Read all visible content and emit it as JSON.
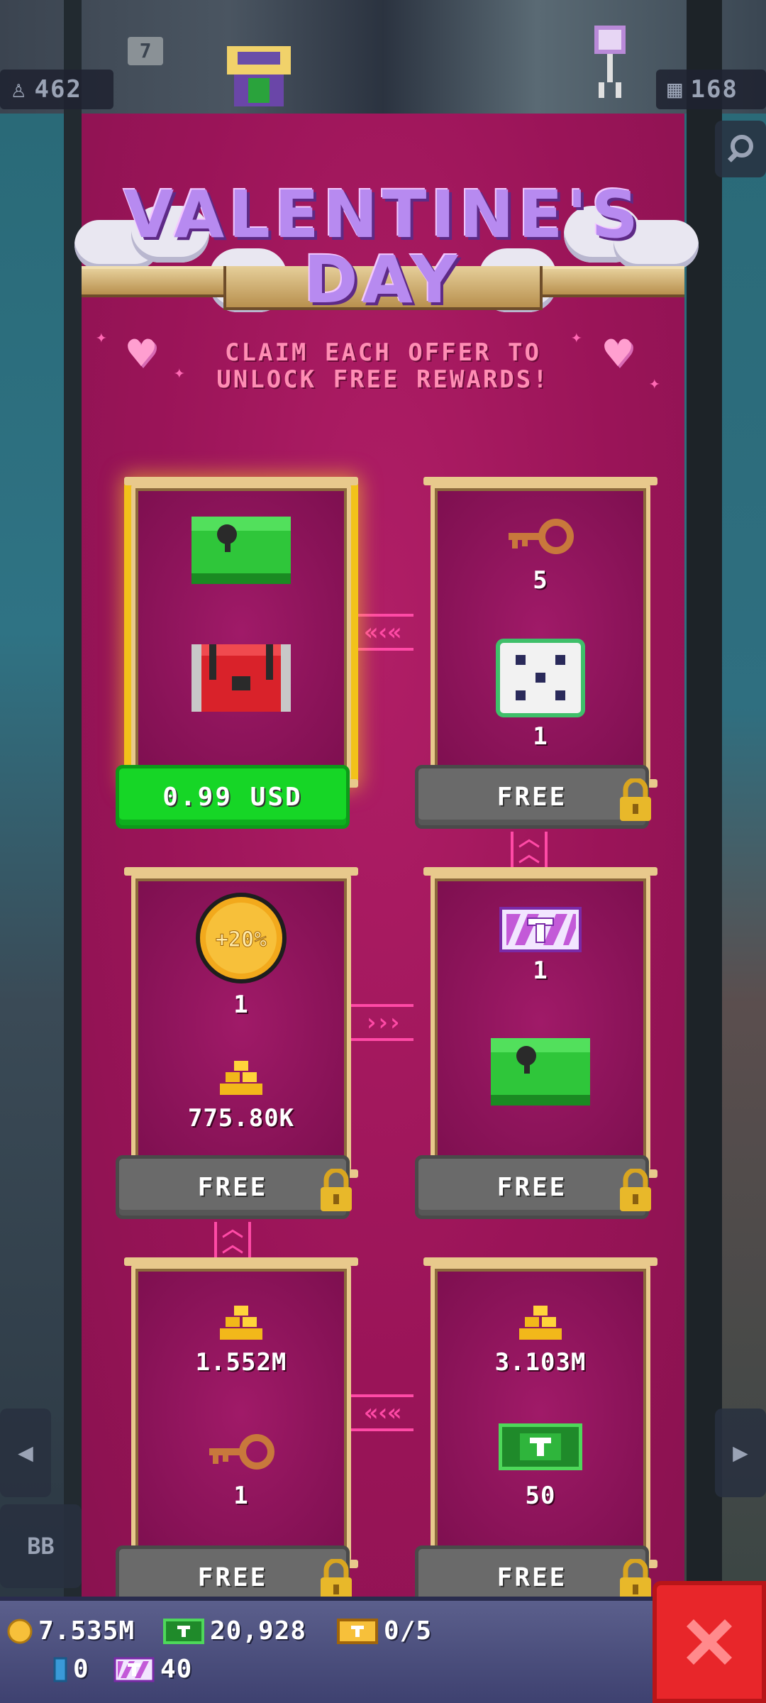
{
  "hud": {
    "population": "462",
    "floors": "168",
    "floor_badge": "7"
  },
  "nav": {
    "bb_label": "BB"
  },
  "event": {
    "title_line1": "VALENTINE'S",
    "title_line2": "DAY",
    "subtitle_line1": "CLAIM EACH OFFER TO",
    "subtitle_line2": "UNLOCK FREE REWARDS!"
  },
  "offers": [
    {
      "items": [
        {
          "icon": "green-chest-icon",
          "label": ""
        },
        {
          "icon": "red-chest-icon",
          "label": ""
        }
      ],
      "button": "0.99 USD",
      "locked": false
    },
    {
      "items": [
        {
          "icon": "key-icon",
          "label": "5"
        },
        {
          "icon": "dice-icon",
          "label": "1"
        }
      ],
      "button": "FREE",
      "locked": true
    },
    {
      "items": [
        {
          "icon": "coin-boost-icon",
          "label": "1",
          "text": "+20%"
        },
        {
          "icon": "gold-stack-icon",
          "label": "775.80K"
        }
      ],
      "button": "FREE",
      "locked": true
    },
    {
      "items": [
        {
          "icon": "ticket-icon",
          "label": "1"
        },
        {
          "icon": "green-chest-icon",
          "label": ""
        }
      ],
      "button": "FREE",
      "locked": true
    },
    {
      "items": [
        {
          "icon": "gold-stack-icon",
          "label": "1.552M"
        },
        {
          "icon": "key-icon",
          "label": "1"
        }
      ],
      "button": "FREE",
      "locked": true
    },
    {
      "items": [
        {
          "icon": "gold-stack-icon",
          "label": "3.103M"
        },
        {
          "icon": "bux-icon",
          "label": "50"
        }
      ],
      "button": "FREE",
      "locked": true
    }
  ],
  "resources": {
    "coins": "7.535M",
    "bux": "20,928",
    "golden_tickets": "0/5",
    "gems": "0",
    "tickets": "40"
  },
  "colors": {
    "panel": "#9a1458",
    "buy_button": "#16d626",
    "free_button": "#6a6a6a",
    "gold_frame": "#e8c98c",
    "close_button": "#e8262a"
  }
}
